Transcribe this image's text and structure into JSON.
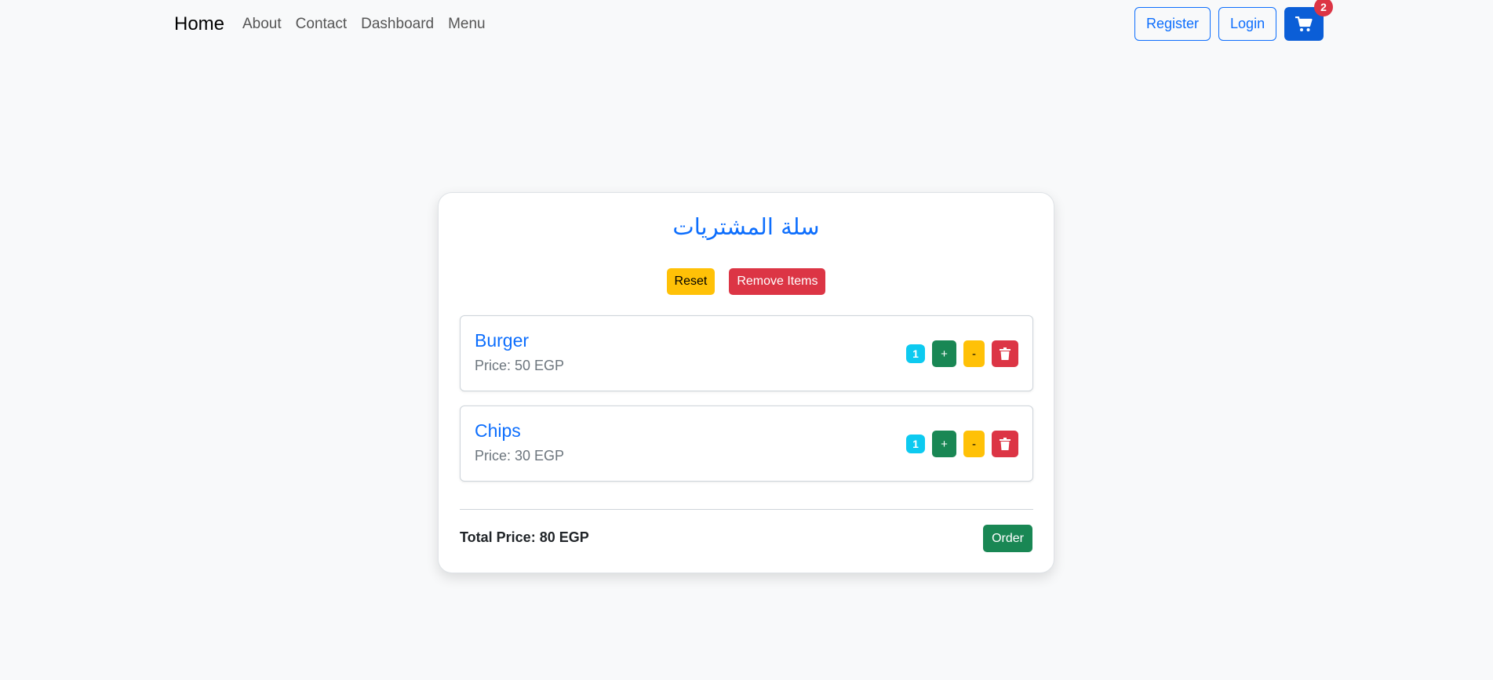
{
  "navbar": {
    "brand": "Home",
    "links": [
      "About",
      "Contact",
      "Dashboard",
      "Menu"
    ],
    "register_label": "Register",
    "login_label": "Login",
    "cart_count": "2",
    "cart_icon": "cart-icon"
  },
  "cart": {
    "title": "سلة المشتريات",
    "reset_label": "Reset",
    "remove_items_label": "Remove Items",
    "items": [
      {
        "name": "Burger",
        "price": "Price: 50 EGP",
        "quantity": "1",
        "plus": "+",
        "minus": "-",
        "delete_icon": "trash-icon"
      },
      {
        "name": "Chips",
        "price": "Price: 30 EGP",
        "quantity": "1",
        "plus": "+",
        "minus": "-",
        "delete_icon": "trash-icon"
      }
    ],
    "total": "Total Price: 80 EGP",
    "order_label": "Order"
  },
  "colors": {
    "primary": "#0d6efd",
    "success": "#198754",
    "warning": "#ffc107",
    "danger": "#dc3545",
    "info": "#0dcaf0",
    "background": "#f8f9fa"
  }
}
